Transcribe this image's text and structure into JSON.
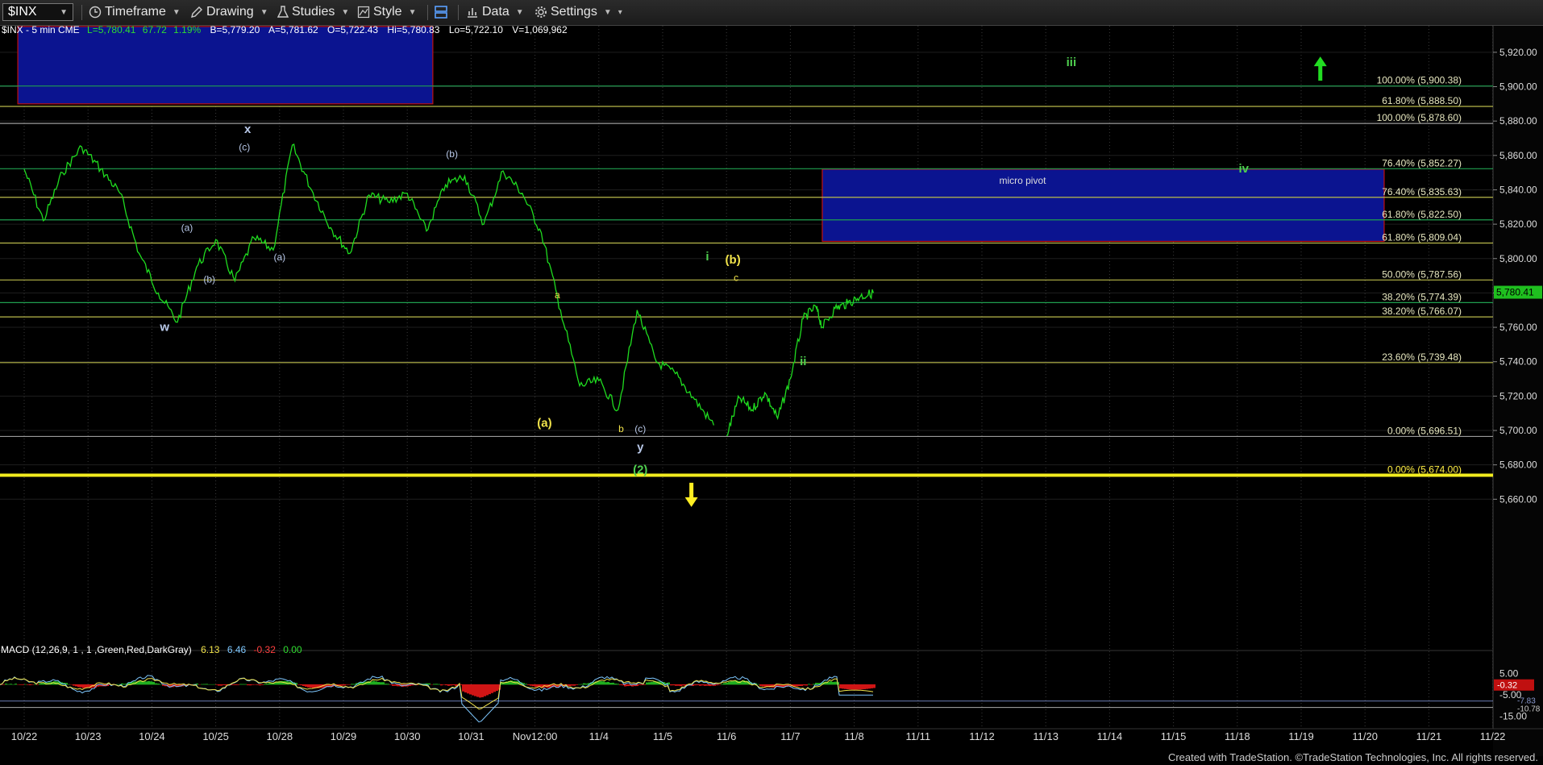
{
  "toolbar": {
    "symbol": "$INX",
    "timeframe": "Timeframe",
    "drawing": "Drawing",
    "studies": "Studies",
    "style": "Style",
    "data": "Data",
    "settings": "Settings"
  },
  "quote_line": {
    "symbol_info": "$INX - 5 min  CME",
    "last": "L=5,780.41",
    "change": "67.72",
    "change_pct": "1.19%",
    "bid": "B=5,779.20",
    "ask": "A=5,781.62",
    "open": "O=5,722.43",
    "high": "Hi=5,780.83",
    "low": "Lo=5,722.10",
    "volume": "V=1,069,962"
  },
  "macd": {
    "label": "MACD (12,26,9, 1 , 1 ,Green,Red,DarkGray)",
    "v1": "6.13",
    "v2": "6.46",
    "v3": "-0.32",
    "v4": "0.00",
    "scale": [
      "5.00",
      "-5.00",
      "-15.00"
    ],
    "hist_marker": "-0.32",
    "lower_markers": [
      "-7.83",
      "-10.78"
    ]
  },
  "colors": {
    "price": "#1fdc1f",
    "fib_green": "#1f9e4f",
    "fib_yellow": "#b8b84a",
    "fib_gray": "#9a9a9a",
    "box_fill": "#0b1490",
    "box_border": "#c01010",
    "thick_line": "#f2ec1e",
    "wave_white": "#b8c8e8",
    "wave_yellow": "#f0e24a",
    "wave_green": "#4fd04f"
  },
  "chart_data": {
    "type": "line",
    "title": "",
    "xlabel": "",
    "ylabel": "",
    "ylim": [
      5645,
      5928
    ],
    "x_ticks": [
      "10/22",
      "10/23",
      "10/24",
      "10/25",
      "10/28",
      "10/29",
      "10/30",
      "10/31",
      "Nov12:00",
      "11/4",
      "11/5",
      "11/6",
      "11/7",
      "11/8",
      "11/11",
      "11/12",
      "11/13",
      "11/14",
      "11/15",
      "11/18",
      "11/19",
      "11/20",
      "11/21",
      "11/22"
    ],
    "y_ticks": [
      "5,920.00",
      "5,900.00",
      "5,880.00",
      "5,860.00",
      "5,840.00",
      "5,820.00",
      "5,800.00",
      "5,780.00",
      "5,760.00",
      "5,740.00",
      "5,720.00",
      "5,700.00",
      "5,680.00",
      "5,660.00"
    ],
    "last_price_tag": "5,780.41",
    "series": [
      {
        "x": [
          0,
          0.3,
          0.6,
          0.9,
          1.2,
          1.5,
          1.8,
          2.1,
          2.4,
          2.7,
          3.0,
          3.3,
          3.6,
          3.9,
          4.2,
          4.5,
          4.8,
          5.1,
          5.4,
          5.7,
          6.0,
          6.3,
          6.6,
          6.9,
          7.2,
          7.5,
          7.8,
          8.1,
          8.4,
          8.7,
          9.0,
          9.3,
          9.6,
          9.9,
          10.2,
          10.5,
          10.8
        ],
        "y": [
          5852,
          5822,
          5850,
          5865,
          5852,
          5838,
          5803,
          5780,
          5763,
          5795,
          5811,
          5787,
          5812,
          5805,
          5866,
          5840,
          5818,
          5803,
          5837,
          5833,
          5838,
          5816,
          5843,
          5848,
          5820,
          5851,
          5838,
          5815,
          5770,
          5726,
          5729,
          5712,
          5770,
          5740,
          5733,
          5718,
          5703
        ]
      },
      {
        "x": [
          11.0,
          11.2,
          11.4,
          11.6,
          11.8,
          12.0,
          12.2,
          12.4,
          12.5,
          12.7,
          12.9,
          13.1,
          13.3
        ],
        "y": [
          5697,
          5719,
          5712,
          5722,
          5707,
          5730,
          5765,
          5772,
          5760,
          5771,
          5774,
          5778,
          5780
        ]
      }
    ],
    "fib_levels": [
      {
        "label": "100.00% (5,900.38)",
        "value": 5900.38,
        "color": "green"
      },
      {
        "label": "61.80% (5,888.50)",
        "value": 5888.5,
        "color": "yellow"
      },
      {
        "label": "100.00% (5,878.60)",
        "value": 5878.6,
        "color": "gray"
      },
      {
        "label": "76.40% (5,852.27)",
        "value": 5852.27,
        "color": "green"
      },
      {
        "label": "76.40% (5,835.63)",
        "value": 5835.63,
        "color": "yellow"
      },
      {
        "label": "61.80% (5,822.50)",
        "value": 5822.5,
        "color": "green"
      },
      {
        "label": "61.80% (5,809.04)",
        "value": 5809.04,
        "color": "yellow"
      },
      {
        "label": "50.00% (5,787.56)",
        "value": 5787.56,
        "color": "yellow"
      },
      {
        "label": "38.20% (5,774.39)",
        "value": 5774.39,
        "color": "green"
      },
      {
        "label": "38.20% (5,766.07)",
        "value": 5766.07,
        "color": "yellow"
      },
      {
        "label": "23.60% (5,739.48)",
        "value": 5739.48,
        "color": "yellow"
      },
      {
        "label": "0.00% (5,696.51)",
        "value": 5696.51,
        "color": "gray"
      },
      {
        "label": "0.00% (5,674.00)",
        "value": 5674.0,
        "color": "thick"
      }
    ],
    "boxes": [
      {
        "label": "",
        "x_from": -0.1,
        "x_to": 6.4,
        "y_from": 5890,
        "y_to": 5935
      },
      {
        "label": "micro pivot",
        "x_from": 12.5,
        "x_to": 21.3,
        "y_from": 5810,
        "y_to": 5852
      }
    ],
    "wave_labels": [
      {
        "text": "w",
        "x": 2.2,
        "y": 5758,
        "color": "white"
      },
      {
        "text": "(a)",
        "x": 2.55,
        "y": 5816,
        "color": "white"
      },
      {
        "text": "(b)",
        "x": 2.9,
        "y": 5786,
        "color": "white"
      },
      {
        "text": "x",
        "x": 3.5,
        "y": 5873,
        "color": "white"
      },
      {
        "text": "(c)",
        "x": 3.45,
        "y": 5863,
        "color": "white"
      },
      {
        "text": "(a)",
        "x": 4.0,
        "y": 5799,
        "color": "white"
      },
      {
        "text": "(b)",
        "x": 6.7,
        "y": 5859,
        "color": "white"
      },
      {
        "text": "a",
        "x": 8.35,
        "y": 5777,
        "color": "yellow"
      },
      {
        "text": "(a)",
        "x": 8.15,
        "y": 5702,
        "color": "yellow"
      },
      {
        "text": "b",
        "x": 9.35,
        "y": 5699,
        "color": "yellow"
      },
      {
        "text": "(c)",
        "x": 9.65,
        "y": 5699,
        "color": "white"
      },
      {
        "text": "y",
        "x": 9.65,
        "y": 5688,
        "color": "white"
      },
      {
        "text": "(2)",
        "x": 9.65,
        "y": 5675,
        "color": "green"
      },
      {
        "text": "i",
        "x": 10.7,
        "y": 5799,
        "color": "green"
      },
      {
        "text": "(b)",
        "x": 11.1,
        "y": 5797,
        "color": "yellow"
      },
      {
        "text": "c",
        "x": 11.15,
        "y": 5787,
        "color": "yellow"
      },
      {
        "text": "ii",
        "x": 12.2,
        "y": 5738,
        "color": "green"
      },
      {
        "text": "iii",
        "x": 16.4,
        "y": 5912,
        "color": "green"
      },
      {
        "text": "iv",
        "x": 19.1,
        "y": 5850,
        "color": "green"
      }
    ],
    "arrows": [
      {
        "direction": "up",
        "x": 20.3,
        "y": 5910,
        "color": "green"
      },
      {
        "direction": "down",
        "x": 10.45,
        "y": 5663,
        "color": "yellow"
      }
    ]
  },
  "footer": "Created with TradeStation. ©TradeStation Technologies, Inc. All rights reserved."
}
